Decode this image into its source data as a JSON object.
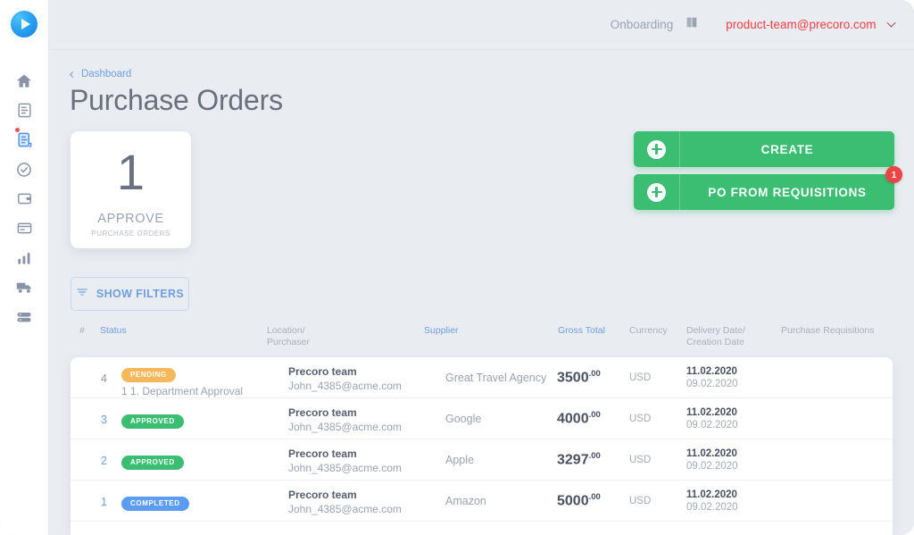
{
  "sidebar": {
    "logo_name": "precoro-logo",
    "items": [
      {
        "icon": "home-icon",
        "active": false,
        "dot": false
      },
      {
        "icon": "document-icon",
        "active": false,
        "dot": false
      },
      {
        "icon": "purchase-order-icon",
        "active": true,
        "dot": true
      },
      {
        "icon": "check-circle-icon",
        "active": false,
        "dot": false
      },
      {
        "icon": "wallet-icon",
        "active": false,
        "dot": false
      },
      {
        "icon": "card-icon",
        "active": false,
        "dot": false
      },
      {
        "icon": "chart-icon",
        "active": false,
        "dot": false
      },
      {
        "icon": "truck-icon",
        "active": false,
        "dot": false
      },
      {
        "icon": "database-icon",
        "active": false,
        "dot": false
      }
    ]
  },
  "topbar": {
    "onboarding_label": "Onboarding",
    "book_icon": "book-icon",
    "user_email": "product-team@precoro.com",
    "chevron_icon": "chevron-down-icon"
  },
  "breadcrumb": {
    "label": "Dashboard"
  },
  "page": {
    "title": "Purchase Orders"
  },
  "stat_card": {
    "number": "1",
    "label": "APPROVE",
    "sub_label": "PURCHASE ORDERS"
  },
  "actions": {
    "create_label": "CREATE",
    "po_from_requisitions_label": "PO FROM REQUISITIONS",
    "po_badge_count": "1",
    "plus_icon": "plus-circle-icon"
  },
  "filters": {
    "label": "SHOW FILTERS",
    "icon": "filter-icon"
  },
  "table": {
    "columns": [
      {
        "label": "#",
        "link": false
      },
      {
        "label": "Status",
        "link": true
      },
      {
        "label": "Location/",
        "link": false
      },
      {
        "label": "Purchaser",
        "link": false
      },
      {
        "label": "Supplier",
        "link": true
      },
      {
        "label": "Gross Total",
        "link": true
      },
      {
        "label": "Currency",
        "link": false
      },
      {
        "label": "Delivery Date/",
        "link": false
      },
      {
        "label": "Creation Date",
        "link": false
      },
      {
        "label": "Purchase Requisitions",
        "link": false
      }
    ],
    "rows": [
      {
        "num": "4",
        "num_link": false,
        "status": "PENDING",
        "status_type": "pending",
        "approval": "1 1. Department Approval",
        "location": "Precoro team",
        "purchaser": "John_4385@acme.com",
        "supplier": "Great Travel Agency",
        "amount": "3500",
        "cents": ".00",
        "currency": "USD",
        "delivery_date": "11.02.2020",
        "creation_date": "09.02.2020",
        "requisitions": ""
      },
      {
        "num": "3",
        "num_link": true,
        "status": "APPROVED",
        "status_type": "approved",
        "approval": "",
        "location": "Precoro team",
        "purchaser": "John_4385@acme.com",
        "supplier": "Google",
        "amount": "4000",
        "cents": ".00",
        "currency": "USD",
        "delivery_date": "11.02.2020",
        "creation_date": "09.02.2020",
        "requisitions": ""
      },
      {
        "num": "2",
        "num_link": true,
        "status": "APPROVED",
        "status_type": "approved",
        "approval": "",
        "location": "Precoro team",
        "purchaser": "John_4385@acme.com",
        "supplier": "Apple",
        "amount": "3297",
        "cents": ".00",
        "currency": "USD",
        "delivery_date": "11.02.2020",
        "creation_date": "09.02.2020",
        "requisitions": ""
      },
      {
        "num": "1",
        "num_link": true,
        "status": "COMPLETED",
        "status_type": "completed",
        "approval": "",
        "location": "Precoro team",
        "purchaser": "John_4385@acme.com",
        "supplier": "Amazon",
        "amount": "5000",
        "cents": ".00",
        "currency": "USD",
        "delivery_date": "11.02.2020",
        "creation_date": "09.02.2020",
        "requisitions": ""
      }
    ]
  },
  "colors": {
    "accent_green": "#3bbd72",
    "accent_blue": "#6f9fe0",
    "pending_orange": "#f5b95c",
    "completed_blue": "#5b9bf0",
    "danger_red": "#ef3e42",
    "page_bg": "#e9ecf1"
  }
}
